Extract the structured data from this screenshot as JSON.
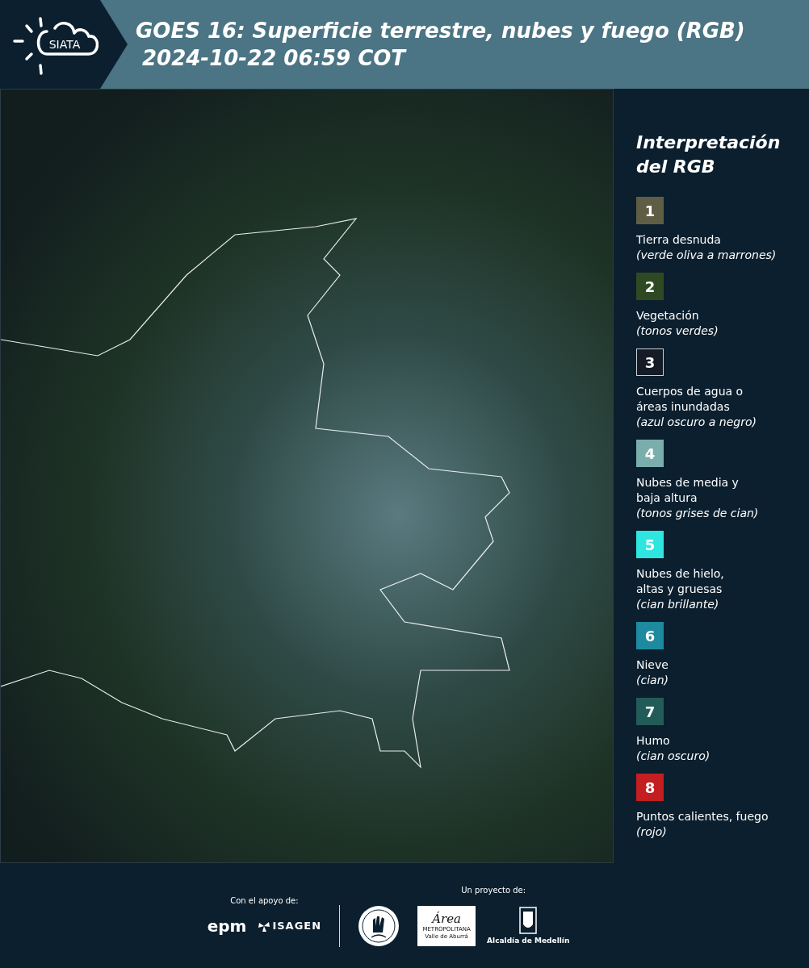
{
  "header": {
    "logo_text": "SIATA",
    "title_lines": [
      "GOES 16: Superficie terrestre, nubes y fuego (RGB)",
      "2024-10-22 06:59 COT"
    ]
  },
  "legend": {
    "title_lines": [
      "Interpretación",
      "del RGB"
    ],
    "items": [
      {
        "number": "1",
        "color": "#5f5e45",
        "label_lines": [
          "Tierra desnuda"
        ],
        "description": "(verde oliva a marrones)"
      },
      {
        "number": "2",
        "color": "#2f4a22",
        "label_lines": [
          "Vegetación"
        ],
        "description": "(tonos verdes)"
      },
      {
        "number": "3",
        "color": "#151c26",
        "label_lines": [
          "Cuerpos de agua o",
          "áreas inundadas"
        ],
        "description": "(azul oscuro a negro)"
      },
      {
        "number": "4",
        "color": "#7aaeac",
        "label_lines": [
          "Nubes de media y",
          "baja altura"
        ],
        "description": "(tonos grises de cian)"
      },
      {
        "number": "5",
        "color": "#2ee6df",
        "label_lines": [
          "Nubes de hielo,",
          "altas y gruesas"
        ],
        "description": "(cian brillante)"
      },
      {
        "number": "6",
        "color": "#1e8aa0",
        "label_lines": [
          "Nieve"
        ],
        "description": "(cian)"
      },
      {
        "number": "7",
        "color": "#225c58",
        "label_lines": [
          "Humo"
        ],
        "description": "(cian oscuro)"
      },
      {
        "number": "8",
        "color": "#c31e20",
        "label_lines": [
          "Puntos calientes, fuego"
        ],
        "description": "(rojo)"
      }
    ]
  },
  "footer": {
    "support_label": "Con el apoyo de:",
    "support_logos": [
      "epm",
      "ISAGEN"
    ],
    "project_label": "Un proyecto de:",
    "area_logo": {
      "script": "Área",
      "lines": [
        "METROPOLITANA",
        "Valle de Aburrá"
      ]
    },
    "city_logo": "Alcaldía de Medellín"
  }
}
